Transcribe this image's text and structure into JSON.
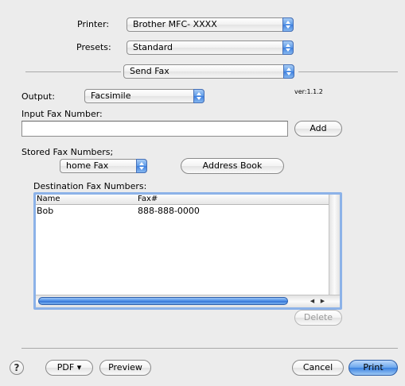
{
  "printer": {
    "label": "Printer:",
    "value": "Brother MFC- XXXX"
  },
  "presets": {
    "label": "Presets:",
    "value": "Standard"
  },
  "pane_select": {
    "value": "Send Fax"
  },
  "output": {
    "label": "Output:",
    "value": "Facsimile"
  },
  "version": "ver:1.1.2",
  "input_fax": {
    "label": "Input Fax Number:",
    "value": "",
    "add_label": "Add"
  },
  "stored": {
    "label": "Stored Fax Numbers;",
    "value": "home Fax",
    "address_book_label": "Address Book"
  },
  "destination": {
    "label": "Destination Fax Numbers:",
    "columns": [
      "Name",
      "Fax#"
    ],
    "rows": [
      {
        "name": "Bob",
        "fax": "888-888-0000"
      }
    ],
    "delete_label": "Delete"
  },
  "footer": {
    "help_glyph": "?",
    "pdf_label": "PDF ▾",
    "preview_label": "Preview",
    "cancel_label": "Cancel",
    "print_label": "Print"
  },
  "colors": {
    "accent": "#3c82e0",
    "selection_border": "#8cb2e8",
    "window_bg": "#ececec"
  },
  "icons": {
    "help": "help-icon",
    "popup": "popup-arrows-icon",
    "scroll_left": "scroll-left-arrow-icon",
    "scroll_right": "scroll-right-arrow-icon"
  }
}
